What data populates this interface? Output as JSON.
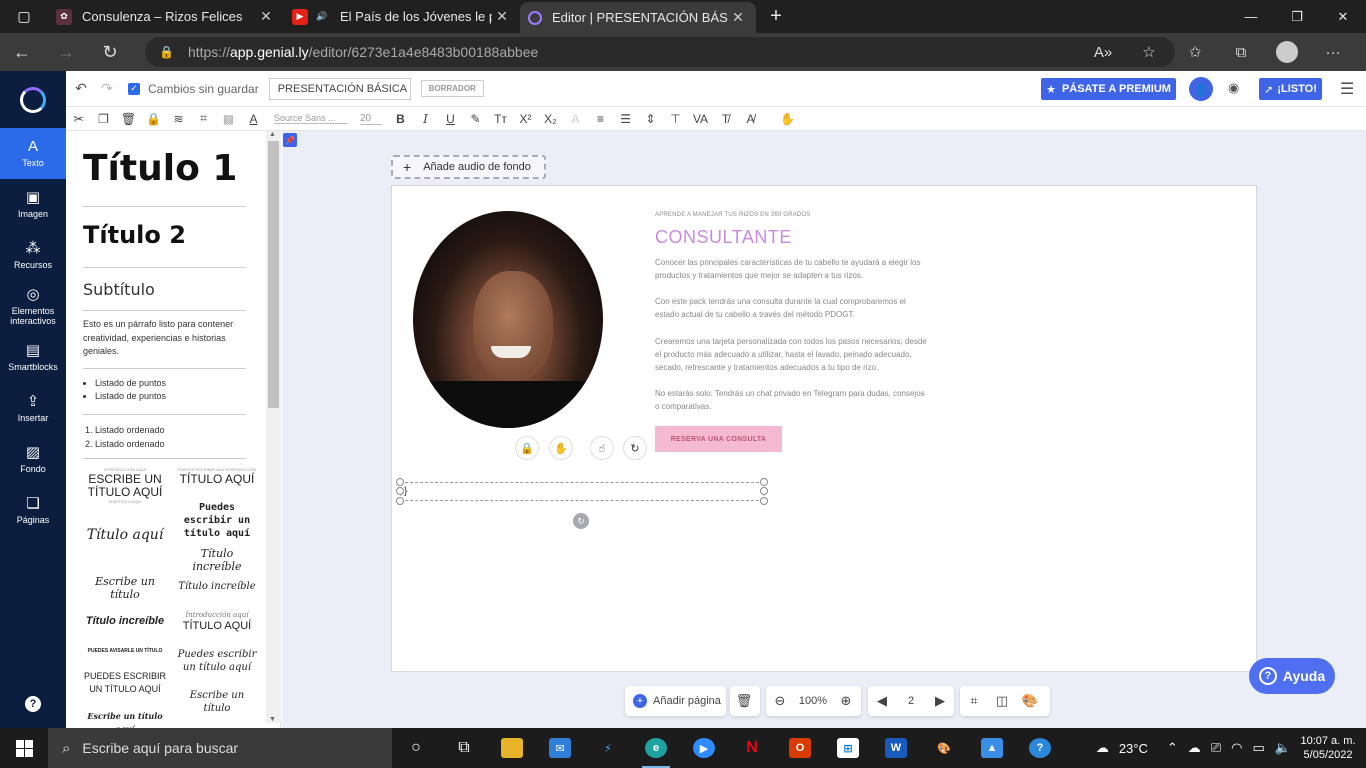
{
  "browser": {
    "tabs": [
      {
        "title": "Consulenza – Rizos Felices",
        "active": false
      },
      {
        "title": "El País de los Jóvenes le pre",
        "active": false
      },
      {
        "title": "Editor | PRESENTACIÓN BÁSICA",
        "active": true
      }
    ],
    "url_prefix": "https://",
    "url_host": "app.genial.ly",
    "url_path": "/editor/6273e1a4e8483b00188abbee"
  },
  "sidebar": {
    "items": [
      {
        "label": "Texto",
        "icon": "text-icon"
      },
      {
        "label": "Imagen",
        "icon": "image-icon"
      },
      {
        "label": "Recursos",
        "icon": "resources-icon"
      },
      {
        "label": "Elementos interactivos",
        "icon": "interactive-icon"
      },
      {
        "label": "Smartblocks",
        "icon": "smartblocks-icon"
      },
      {
        "label": "Insertar",
        "icon": "insert-icon"
      },
      {
        "label": "Fondo",
        "icon": "background-icon"
      },
      {
        "label": "Páginas",
        "icon": "pages-icon"
      }
    ],
    "help": "?"
  },
  "topbar": {
    "unsaved": "Cambios sin guardar",
    "title_value": "PRESENTACIÓN BÁSICA",
    "draft": "BORRADOR",
    "premium": "PÁSATE A PREMIUM",
    "ready": "¡LISTO!"
  },
  "format": {
    "font": "Source Sans ...",
    "size": "20"
  },
  "panel": {
    "h1": "Título 1",
    "h2": "Título 2",
    "subtitle": "Subtítulo",
    "paragraph": "Esto es un párrafo listo para contener creatividad, experiencias e historias geniales.",
    "bullets": [
      "Listado de puntos",
      "Listado de puntos"
    ],
    "ordered": [
      "Listado ordenado",
      "Listado ordenado"
    ],
    "styles": [
      {
        "kicker": "INTRODUCCIÓN AQUÍ",
        "text": "ESCRIBE UN TÍTULO AQUÍ",
        "sub": "SUBTÍTULO AQUÍ"
      },
      {
        "kicker": "PUEDES ESCRIBIR UNA INTRODUCCIÓN",
        "text": "TÍTULO AQUÍ"
      },
      {
        "text": "Puedes escribir un título aquí"
      },
      {
        "text": "Título aquí"
      },
      {
        "text": "Título increíble"
      },
      {
        "text": "Escribe un título"
      },
      {
        "text": "Título increíble"
      },
      {
        "text": "Título increíble"
      },
      {
        "text": "Introducción aquí"
      },
      {
        "text": "TÍTULO AQUÍ"
      },
      {
        "text": "PUEDES AVISARLE UN TÍTULO"
      },
      {
        "text": "Puedes escribir un título aquí"
      },
      {
        "text": "PUEDES ESCRIBIR UN TÍTULO AQUÍ"
      },
      {
        "text": "Escribe un título"
      },
      {
        "text": "Escribe un título aquí"
      }
    ]
  },
  "canvas": {
    "audio_button": "Añade audio de fondo",
    "slide": {
      "kicker": "APRENDE A MANEJAR TUS RIZOS EN 360 GRADOS",
      "heading": "CONSULTANTE",
      "p1": "Conocer las principales características de tu cabello te ayudará a elegir los productos y tratamientos que mejor se adapten a tus rizos.",
      "p2": "Con este pack tendrás una consulta durante la cual comprobaremos el estado actual de tu cabello a través del método PDOGT.",
      "p3": "Crearemos una tarjeta personalizada con todos los pasos necesarios, desde el producto más adecuado a utilizar, hasta el lavado, peinado adecuado, secado, refrescante y tratamientos adecuados a tu tipo de rizo.",
      "p4": "No estarás solo: Tendrás un chat privado en Telegram para dudas, consejos o comparativas.",
      "cta": "RESERVA UNA CONSULTA",
      "caret": "}"
    }
  },
  "bottom": {
    "add_page": "Añadir página",
    "zoom": "100%",
    "page": "2"
  },
  "help_button": "Ayuda",
  "taskbar": {
    "search_placeholder": "Escribe aquí para buscar",
    "weather": "23°C",
    "time": "10:07 a. m.",
    "date": "5/05/2022"
  },
  "colors": {
    "sidebar_bg": "#0b1e3f",
    "accent": "#3f65e6",
    "heading_pink": "#c98be0",
    "cta_bg": "#f6b9d2"
  }
}
